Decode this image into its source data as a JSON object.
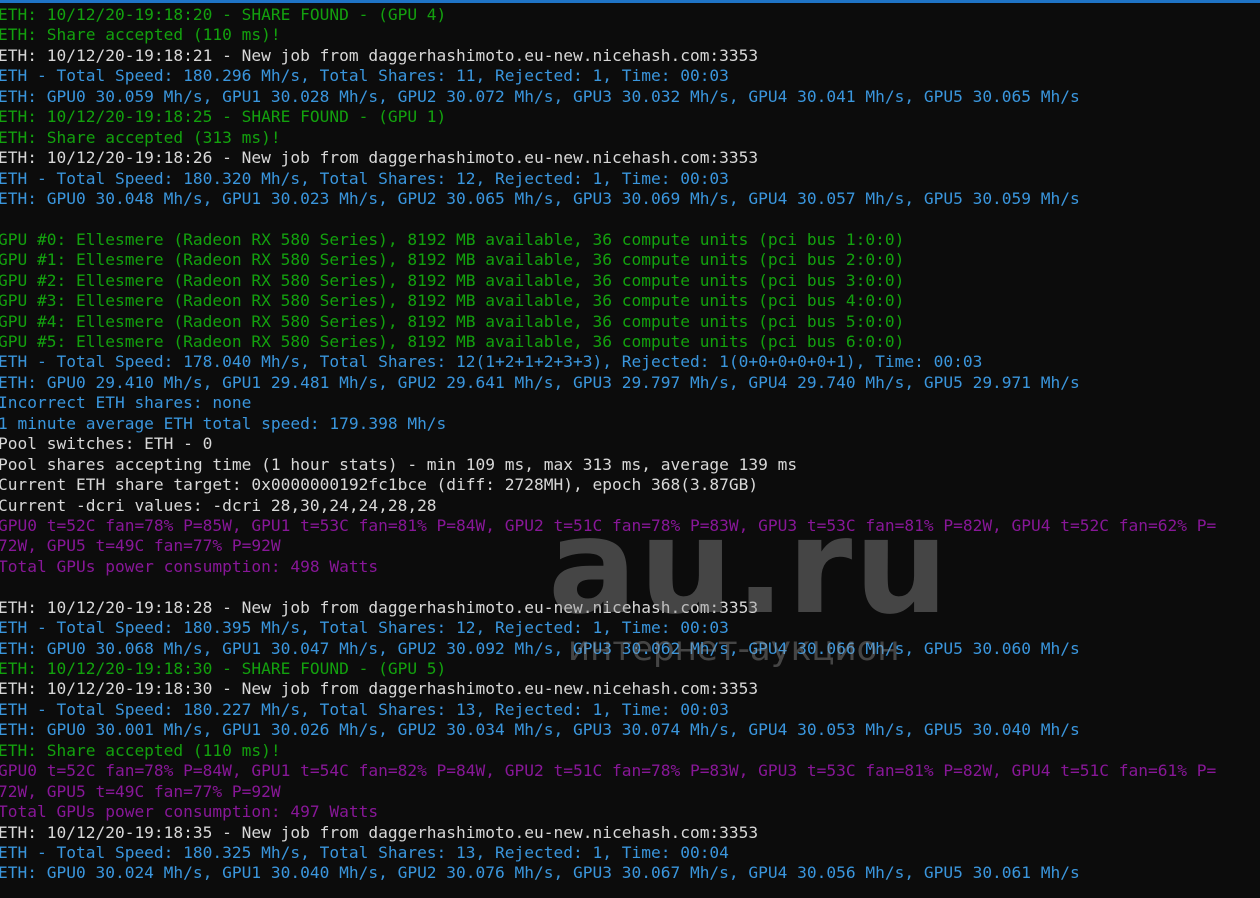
{
  "colors": {
    "background": "#0c0c0c",
    "white": "#d8d8d8",
    "green": "#13a10e",
    "cyan": "#3a96dd",
    "purple": "#881798",
    "title_bar_accent": "#1f74c6"
  },
  "watermark": {
    "logo": "au.ru",
    "subtitle": "интернет-аукцион"
  },
  "lines": [
    {
      "color": "green",
      "text": "ETH: 10/12/20-19:18:20 - SHARE FOUND - (GPU 4)"
    },
    {
      "color": "green",
      "text": "ETH: Share accepted (110 ms)!"
    },
    {
      "color": "white",
      "text": "ETH: 10/12/20-19:18:21 - New job from daggerhashimoto.eu-new.nicehash.com:3353"
    },
    {
      "color": "cyan",
      "text": "ETH - Total Speed: 180.296 Mh/s, Total Shares: 11, Rejected: 1, Time: 00:03"
    },
    {
      "color": "cyan",
      "text": "ETH: GPU0 30.059 Mh/s, GPU1 30.028 Mh/s, GPU2 30.072 Mh/s, GPU3 30.032 Mh/s, GPU4 30.041 Mh/s, GPU5 30.065 Mh/s"
    },
    {
      "color": "green",
      "text": "ETH: 10/12/20-19:18:25 - SHARE FOUND - (GPU 1)"
    },
    {
      "color": "green",
      "text": "ETH: Share accepted (313 ms)!"
    },
    {
      "color": "white",
      "text": "ETH: 10/12/20-19:18:26 - New job from daggerhashimoto.eu-new.nicehash.com:3353"
    },
    {
      "color": "cyan",
      "text": "ETH - Total Speed: 180.320 Mh/s, Total Shares: 12, Rejected: 1, Time: 00:03"
    },
    {
      "color": "cyan",
      "text": "ETH: GPU0 30.048 Mh/s, GPU1 30.023 Mh/s, GPU2 30.065 Mh/s, GPU3 30.069 Mh/s, GPU4 30.057 Mh/s, GPU5 30.059 Mh/s"
    },
    {
      "color": "white",
      "text": ""
    },
    {
      "color": "green",
      "text": "GPU #0: Ellesmere (Radeon RX 580 Series), 8192 MB available, 36 compute units (pci bus 1:0:0)"
    },
    {
      "color": "green",
      "text": "GPU #1: Ellesmere (Radeon RX 580 Series), 8192 MB available, 36 compute units (pci bus 2:0:0)"
    },
    {
      "color": "green",
      "text": "GPU #2: Ellesmere (Radeon RX 580 Series), 8192 MB available, 36 compute units (pci bus 3:0:0)"
    },
    {
      "color": "green",
      "text": "GPU #3: Ellesmere (Radeon RX 580 Series), 8192 MB available, 36 compute units (pci bus 4:0:0)"
    },
    {
      "color": "green",
      "text": "GPU #4: Ellesmere (Radeon RX 580 Series), 8192 MB available, 36 compute units (pci bus 5:0:0)"
    },
    {
      "color": "green",
      "text": "GPU #5: Ellesmere (Radeon RX 580 Series), 8192 MB available, 36 compute units (pci bus 6:0:0)"
    },
    {
      "color": "cyan",
      "text": "ETH - Total Speed: 178.040 Mh/s, Total Shares: 12(1+2+1+2+3+3), Rejected: 1(0+0+0+0+0+1), Time: 00:03"
    },
    {
      "color": "cyan",
      "text": "ETH: GPU0 29.410 Mh/s, GPU1 29.481 Mh/s, GPU2 29.641 Mh/s, GPU3 29.797 Mh/s, GPU4 29.740 Mh/s, GPU5 29.971 Mh/s"
    },
    {
      "color": "cyan",
      "text": "Incorrect ETH shares: none"
    },
    {
      "color": "cyan",
      "text": "1 minute average ETH total speed: 179.398 Mh/s"
    },
    {
      "color": "white",
      "text": "Pool switches: ETH - 0"
    },
    {
      "color": "white",
      "text": "Pool shares accepting time (1 hour stats) - min 109 ms, max 313 ms, average 139 ms"
    },
    {
      "color": "white",
      "text": "Current ETH share target: 0x0000000192fc1bce (diff: 2728MH), epoch 368(3.87GB)"
    },
    {
      "color": "white",
      "text": "Current -dcri values: -dcri 28,30,24,24,28,28"
    },
    {
      "color": "purple",
      "text": "GPU0 t=52C fan=78% P=85W, GPU1 t=53C fan=81% P=84W, GPU2 t=51C fan=78% P=83W, GPU3 t=53C fan=81% P=82W, GPU4 t=52C fan=62% P="
    },
    {
      "color": "purple",
      "text": "72W, GPU5 t=49C fan=77% P=92W"
    },
    {
      "color": "purple",
      "text": "Total GPUs power consumption: 498 Watts"
    },
    {
      "color": "white",
      "text": ""
    },
    {
      "color": "white",
      "text": "ETH: 10/12/20-19:18:28 - New job from daggerhashimoto.eu-new.nicehash.com:3353"
    },
    {
      "color": "cyan",
      "text": "ETH - Total Speed: 180.395 Mh/s, Total Shares: 12, Rejected: 1, Time: 00:03"
    },
    {
      "color": "cyan",
      "text": "ETH: GPU0 30.068 Mh/s, GPU1 30.047 Mh/s, GPU2 30.092 Mh/s, GPU3 30.062 Mh/s, GPU4 30.066 Mh/s, GPU5 30.060 Mh/s"
    },
    {
      "color": "green",
      "text": "ETH: 10/12/20-19:18:30 - SHARE FOUND - (GPU 5)"
    },
    {
      "color": "white",
      "text": "ETH: 10/12/20-19:18:30 - New job from daggerhashimoto.eu-new.nicehash.com:3353"
    },
    {
      "color": "cyan",
      "text": "ETH - Total Speed: 180.227 Mh/s, Total Shares: 13, Rejected: 1, Time: 00:03"
    },
    {
      "color": "cyan",
      "text": "ETH: GPU0 30.001 Mh/s, GPU1 30.026 Mh/s, GPU2 30.034 Mh/s, GPU3 30.074 Mh/s, GPU4 30.053 Mh/s, GPU5 30.040 Mh/s"
    },
    {
      "color": "green",
      "text": "ETH: Share accepted (110 ms)!"
    },
    {
      "color": "purple",
      "text": "GPU0 t=52C fan=78% P=84W, GPU1 t=54C fan=82% P=84W, GPU2 t=51C fan=78% P=83W, GPU3 t=53C fan=81% P=82W, GPU4 t=51C fan=61% P="
    },
    {
      "color": "purple",
      "text": "72W, GPU5 t=49C fan=77% P=92W"
    },
    {
      "color": "purple",
      "text": "Total GPUs power consumption: 497 Watts"
    },
    {
      "color": "white",
      "text": "ETH: 10/12/20-19:18:35 - New job from daggerhashimoto.eu-new.nicehash.com:3353"
    },
    {
      "color": "cyan",
      "text": "ETH - Total Speed: 180.325 Mh/s, Total Shares: 13, Rejected: 1, Time: 00:04"
    },
    {
      "color": "cyan",
      "text": "ETH: GPU0 30.024 Mh/s, GPU1 30.040 Mh/s, GPU2 30.076 Mh/s, GPU3 30.067 Mh/s, GPU4 30.056 Mh/s, GPU5 30.061 Mh/s"
    }
  ]
}
